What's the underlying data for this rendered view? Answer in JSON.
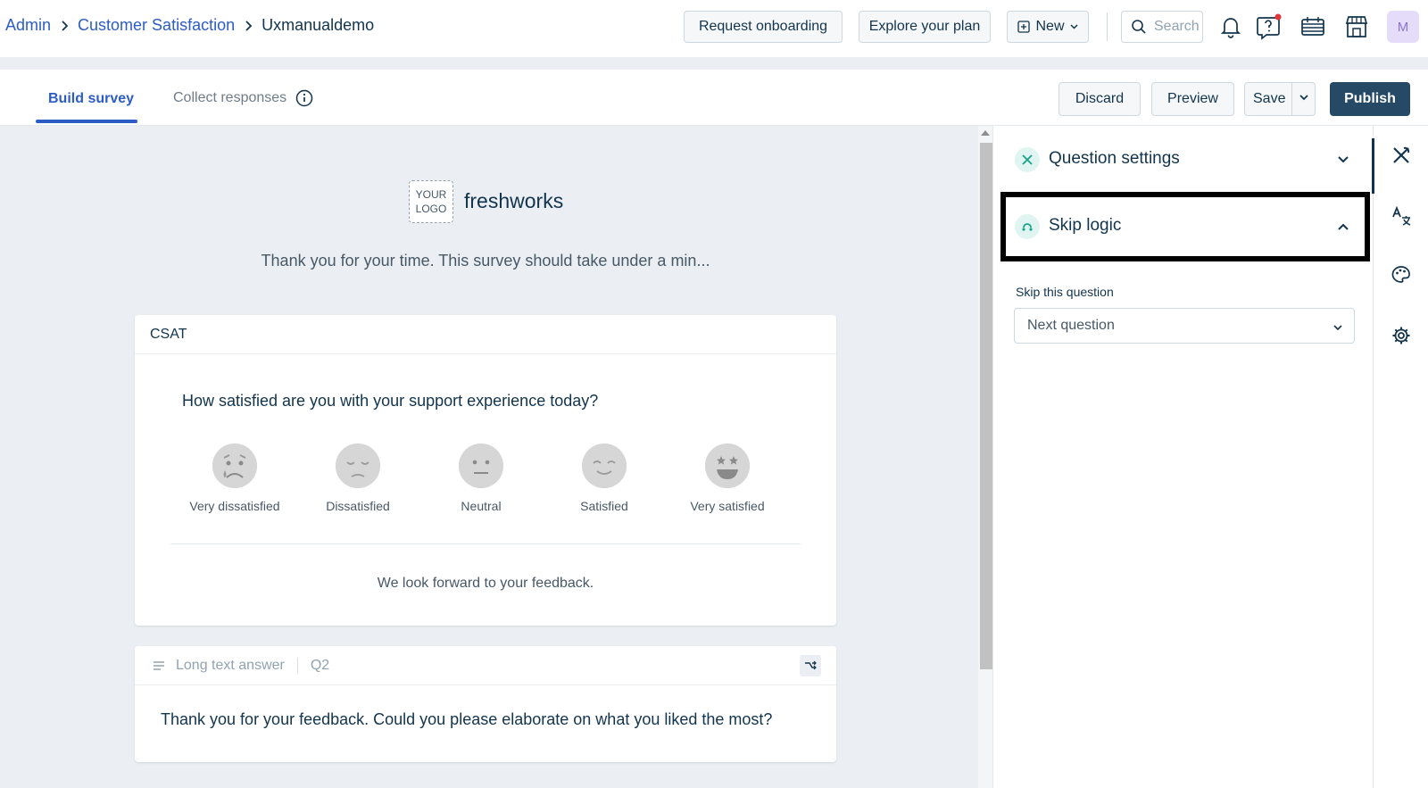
{
  "breadcrumb": {
    "admin": "Admin",
    "section": "Customer Satisfaction",
    "current": "Uxmanualdemo"
  },
  "topbar": {
    "request_onboarding": "Request onboarding",
    "explore_plan": "Explore your plan",
    "new_label": "New",
    "search_placeholder": "Search",
    "avatar_initial": "M"
  },
  "tabs": {
    "build": "Build survey",
    "collect": "Collect responses"
  },
  "actions": {
    "discard": "Discard",
    "preview": "Preview",
    "save": "Save",
    "publish": "Publish"
  },
  "survey": {
    "logo_line1": "YOUR",
    "logo_line2": "LOGO",
    "brand": "freshworks",
    "intro": "Thank you for your time. This survey should take under a min...",
    "q1": {
      "type": "CSAT",
      "title": "How satisfied are you with your support experience today?",
      "options": [
        "Very dissatisfied",
        "Dissatisfied",
        "Neutral",
        "Satisfied",
        "Very satisfied"
      ],
      "closing": "We look forward to your feedback."
    },
    "q2": {
      "type": "Long text answer",
      "number": "Q2",
      "title": "Thank you for your feedback. Could you please elaborate on what you liked the most?"
    }
  },
  "panel": {
    "question_settings": "Question settings",
    "skip_logic": "Skip logic",
    "skip_label": "Skip this question",
    "skip_value": "Next question"
  },
  "colors": {
    "accent": "#2c5cc5",
    "publish": "#264966",
    "canvas": "#ebeff3",
    "teal": "#17a589"
  }
}
